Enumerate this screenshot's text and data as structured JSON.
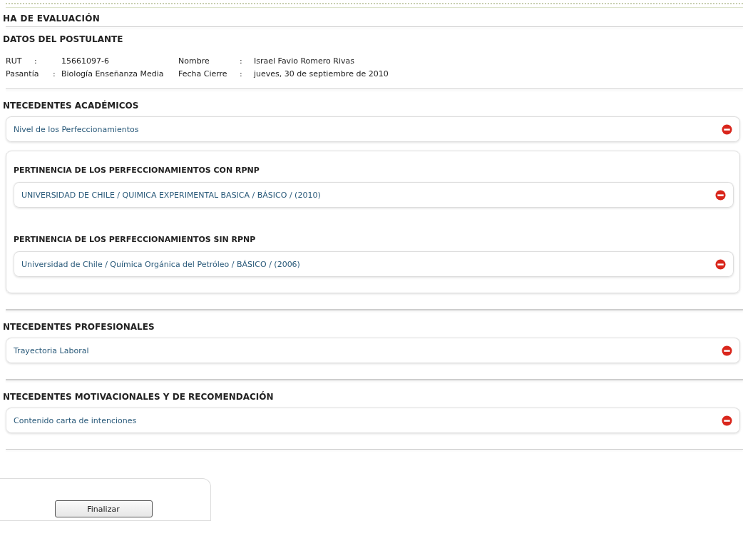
{
  "title": "HA DE EVALUACIÓN",
  "applicant": {
    "heading": "DATOS DEL POSTULANTE",
    "rows": [
      {
        "label": "RUT",
        "sep": ":",
        "value": "15661097-6",
        "label2": "Nombre",
        "sep2": ":",
        "value2": "Israel Favio Romero Rivas"
      },
      {
        "label": "Pasantía",
        "sep": ":",
        "value": "Biología Enseñanza Media",
        "label2": "Fecha Cierre",
        "sep2": ":",
        "value2": "jueves, 30 de septiembre de 2010"
      }
    ]
  },
  "sections": [
    {
      "heading": "NTECEDENTES ACADÉMICOS",
      "items": [
        {
          "kind": "item",
          "label": "Nivel de los Perfeccionamientos"
        },
        {
          "kind": "group",
          "groups": [
            {
              "heading": "PERTINENCIA DE LOS PERFECCIONAMIENTOS CON RPNP",
              "items": [
                {
                  "label": "UNIVERSIDAD DE CHILE / QUIMICA EXPERIMENTAL BASICA / BÁSICO / (2010)"
                }
              ]
            },
            {
              "heading": "PERTINENCIA DE LOS PERFECCIONAMIENTOS SIN RPNP",
              "items": [
                {
                  "label": "Universidad de Chile / Química Orgánica del Petróleo / BÁSICO / (2006)"
                }
              ]
            }
          ]
        }
      ]
    },
    {
      "heading": "NTECEDENTES PROFESIONALES",
      "items": [
        {
          "kind": "item",
          "label": "Trayectoria Laboral"
        }
      ]
    },
    {
      "heading": "NTECEDENTES MOTIVACIONALES Y DE RECOMENDACIÓN",
      "items": [
        {
          "kind": "item",
          "label": "Contenido carta de intenciones"
        }
      ]
    }
  ],
  "button": "Finalizar"
}
